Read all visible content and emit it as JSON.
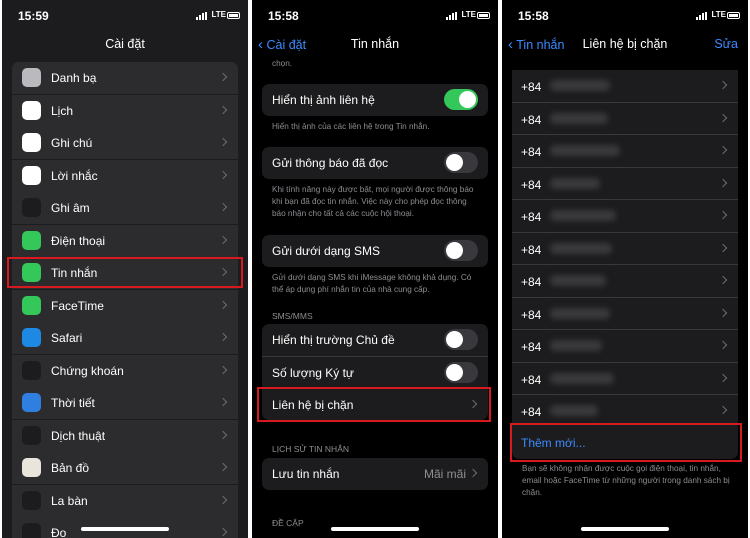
{
  "panel1": {
    "time": "15:59",
    "network": "LTE",
    "title": "Cài đặt",
    "items": [
      {
        "label": "Danh bạ",
        "icon": "contacts-icon",
        "color": "#b9b9be"
      },
      {
        "label": "Lịch",
        "icon": "calendar-icon",
        "color": "#ffffff"
      },
      {
        "label": "Ghi chú",
        "icon": "notes-icon",
        "color": "#ffffff"
      },
      {
        "label": "Lời nhắc",
        "icon": "reminders-icon",
        "color": "#ffffff"
      },
      {
        "label": "Ghi âm",
        "icon": "voice-memos-icon",
        "color": "#1c1c1e"
      },
      {
        "label": "Điện thoại",
        "icon": "phone-icon",
        "color": "#34c759"
      },
      {
        "label": "Tin nhắn",
        "icon": "messages-icon",
        "color": "#34c759"
      },
      {
        "label": "FaceTime",
        "icon": "facetime-icon",
        "color": "#34c759"
      },
      {
        "label": "Safari",
        "icon": "safari-icon",
        "color": "#1e88e5"
      },
      {
        "label": "Chứng khoán",
        "icon": "stocks-icon",
        "color": "#1c1c1e"
      },
      {
        "label": "Thời tiết",
        "icon": "weather-icon",
        "color": "#2f7fe0"
      },
      {
        "label": "Dịch thuật",
        "icon": "translate-icon",
        "color": "#1c1c1e"
      },
      {
        "label": "Bản đồ",
        "icon": "maps-icon",
        "color": "#e9e5dc"
      },
      {
        "label": "La bàn",
        "icon": "compass-icon",
        "color": "#1c1c1e"
      },
      {
        "label": "Đo",
        "icon": "measure-icon",
        "color": "#1c1c1e"
      }
    ]
  },
  "panel2": {
    "time": "15:58",
    "network": "LTE",
    "back": "Cài đặt",
    "title": "Tin nhắn",
    "top_fragment": "chọn.",
    "show_contact_photos": "Hiển thị ảnh liên hệ",
    "show_contact_photos_note": "Hiển thị ảnh của các liên hệ trong Tin nhắn.",
    "read_receipts": "Gửi thông báo đã đọc",
    "read_receipts_note": "Khi tính năng này được bật, mọi người được thông báo khi bạn đã đọc tin nhắn. Việc này cho phép đọc thông báo nhận cho tất cả các cuộc hội thoại.",
    "send_as_sms": "Gửi dưới dạng SMS",
    "send_as_sms_note": "Gửi dưới dạng SMS khi iMessage không khả dụng. Có thể áp dụng phí nhắn tin của nhà cung cấp.",
    "sms_mms_header": "SMS/MMS",
    "subject_field": "Hiển thị trường Chủ đề",
    "char_count": "Số lượng Ký tự",
    "blocked": "Liên hệ bị chặn",
    "history_header": "LỊCH SỬ TIN NHẮN",
    "keep_messages": "Lưu tin nhắn",
    "keep_messages_value": "Mãi mãi",
    "mentions_header": "ĐỀ CẬP"
  },
  "panel3": {
    "time": "15:58",
    "network": "LTE",
    "back": "Tin nhắn",
    "title": "Liên hệ bị chặn",
    "edit": "Sửa",
    "contacts": [
      "+84",
      "+84",
      "+84",
      "+84",
      "+84",
      "+84",
      "+84",
      "+84",
      "+84",
      "+84",
      "+84"
    ],
    "add_new": "Thêm mới...",
    "footer_note": "Bạn sẽ không nhận được cuộc gọi điện thoại, tin nhắn, email hoặc FaceTime từ những người trong danh sách bị chặn."
  },
  "colors": {
    "highlight": "#d71920",
    "accent": "#3b8bff",
    "toggle_on": "#34c759"
  }
}
